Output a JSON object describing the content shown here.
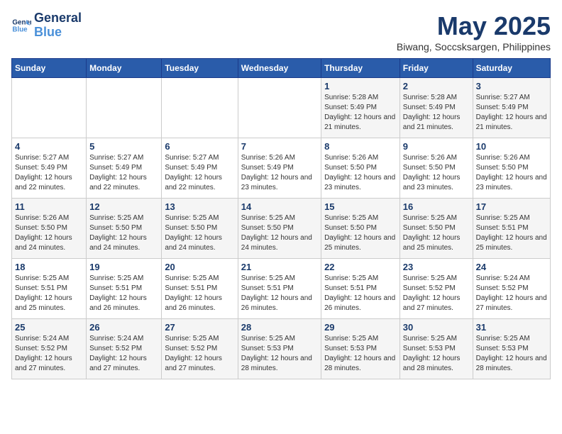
{
  "header": {
    "logo_line1": "General",
    "logo_line2": "Blue",
    "title": "May 2025",
    "subtitle": "Biwang, Soccsksargen, Philippines"
  },
  "days_of_week": [
    "Sunday",
    "Monday",
    "Tuesday",
    "Wednesday",
    "Thursday",
    "Friday",
    "Saturday"
  ],
  "weeks": [
    [
      {
        "day": "",
        "sunrise": "",
        "sunset": "",
        "daylight": ""
      },
      {
        "day": "",
        "sunrise": "",
        "sunset": "",
        "daylight": ""
      },
      {
        "day": "",
        "sunrise": "",
        "sunset": "",
        "daylight": ""
      },
      {
        "day": "",
        "sunrise": "",
        "sunset": "",
        "daylight": ""
      },
      {
        "day": "1",
        "sunrise": "5:28 AM",
        "sunset": "5:49 PM",
        "daylight": "12 hours and 21 minutes."
      },
      {
        "day": "2",
        "sunrise": "5:28 AM",
        "sunset": "5:49 PM",
        "daylight": "12 hours and 21 minutes."
      },
      {
        "day": "3",
        "sunrise": "5:27 AM",
        "sunset": "5:49 PM",
        "daylight": "12 hours and 21 minutes."
      }
    ],
    [
      {
        "day": "4",
        "sunrise": "5:27 AM",
        "sunset": "5:49 PM",
        "daylight": "12 hours and 22 minutes."
      },
      {
        "day": "5",
        "sunrise": "5:27 AM",
        "sunset": "5:49 PM",
        "daylight": "12 hours and 22 minutes."
      },
      {
        "day": "6",
        "sunrise": "5:27 AM",
        "sunset": "5:49 PM",
        "daylight": "12 hours and 22 minutes."
      },
      {
        "day": "7",
        "sunrise": "5:26 AM",
        "sunset": "5:49 PM",
        "daylight": "12 hours and 23 minutes."
      },
      {
        "day": "8",
        "sunrise": "5:26 AM",
        "sunset": "5:50 PM",
        "daylight": "12 hours and 23 minutes."
      },
      {
        "day": "9",
        "sunrise": "5:26 AM",
        "sunset": "5:50 PM",
        "daylight": "12 hours and 23 minutes."
      },
      {
        "day": "10",
        "sunrise": "5:26 AM",
        "sunset": "5:50 PM",
        "daylight": "12 hours and 23 minutes."
      }
    ],
    [
      {
        "day": "11",
        "sunrise": "5:26 AM",
        "sunset": "5:50 PM",
        "daylight": "12 hours and 24 minutes."
      },
      {
        "day": "12",
        "sunrise": "5:25 AM",
        "sunset": "5:50 PM",
        "daylight": "12 hours and 24 minutes."
      },
      {
        "day": "13",
        "sunrise": "5:25 AM",
        "sunset": "5:50 PM",
        "daylight": "12 hours and 24 minutes."
      },
      {
        "day": "14",
        "sunrise": "5:25 AM",
        "sunset": "5:50 PM",
        "daylight": "12 hours and 24 minutes."
      },
      {
        "day": "15",
        "sunrise": "5:25 AM",
        "sunset": "5:50 PM",
        "daylight": "12 hours and 25 minutes."
      },
      {
        "day": "16",
        "sunrise": "5:25 AM",
        "sunset": "5:50 PM",
        "daylight": "12 hours and 25 minutes."
      },
      {
        "day": "17",
        "sunrise": "5:25 AM",
        "sunset": "5:51 PM",
        "daylight": "12 hours and 25 minutes."
      }
    ],
    [
      {
        "day": "18",
        "sunrise": "5:25 AM",
        "sunset": "5:51 PM",
        "daylight": "12 hours and 25 minutes."
      },
      {
        "day": "19",
        "sunrise": "5:25 AM",
        "sunset": "5:51 PM",
        "daylight": "12 hours and 26 minutes."
      },
      {
        "day": "20",
        "sunrise": "5:25 AM",
        "sunset": "5:51 PM",
        "daylight": "12 hours and 26 minutes."
      },
      {
        "day": "21",
        "sunrise": "5:25 AM",
        "sunset": "5:51 PM",
        "daylight": "12 hours and 26 minutes."
      },
      {
        "day": "22",
        "sunrise": "5:25 AM",
        "sunset": "5:51 PM",
        "daylight": "12 hours and 26 minutes."
      },
      {
        "day": "23",
        "sunrise": "5:25 AM",
        "sunset": "5:52 PM",
        "daylight": "12 hours and 27 minutes."
      },
      {
        "day": "24",
        "sunrise": "5:24 AM",
        "sunset": "5:52 PM",
        "daylight": "12 hours and 27 minutes."
      }
    ],
    [
      {
        "day": "25",
        "sunrise": "5:24 AM",
        "sunset": "5:52 PM",
        "daylight": "12 hours and 27 minutes."
      },
      {
        "day": "26",
        "sunrise": "5:24 AM",
        "sunset": "5:52 PM",
        "daylight": "12 hours and 27 minutes."
      },
      {
        "day": "27",
        "sunrise": "5:25 AM",
        "sunset": "5:52 PM",
        "daylight": "12 hours and 27 minutes."
      },
      {
        "day": "28",
        "sunrise": "5:25 AM",
        "sunset": "5:53 PM",
        "daylight": "12 hours and 28 minutes."
      },
      {
        "day": "29",
        "sunrise": "5:25 AM",
        "sunset": "5:53 PM",
        "daylight": "12 hours and 28 minutes."
      },
      {
        "day": "30",
        "sunrise": "5:25 AM",
        "sunset": "5:53 PM",
        "daylight": "12 hours and 28 minutes."
      },
      {
        "day": "31",
        "sunrise": "5:25 AM",
        "sunset": "5:53 PM",
        "daylight": "12 hours and 28 minutes."
      }
    ]
  ],
  "labels": {
    "sunrise": "Sunrise:",
    "sunset": "Sunset:",
    "daylight": "Daylight:"
  }
}
